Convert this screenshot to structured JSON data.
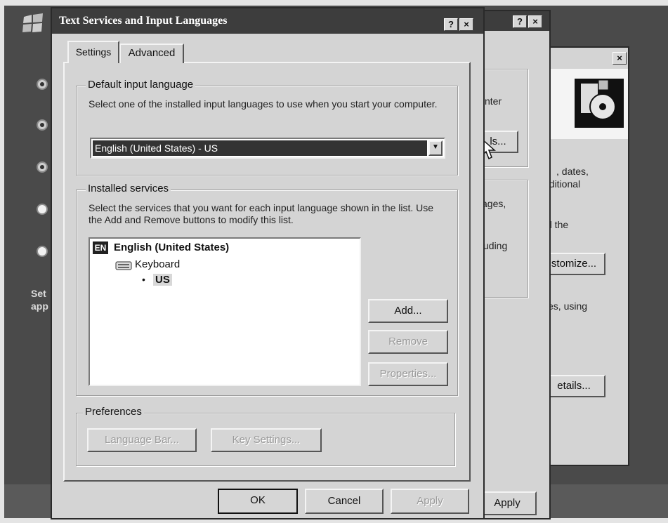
{
  "desktop": {
    "side_text_line1": "Set",
    "side_text_line2": "app"
  },
  "third_window": {
    "frag_dates": ", dates,",
    "frag_additional": "dditional",
    "frag_the": "d the",
    "customize_button": "stomize...",
    "frag_using": "es, using",
    "details_button": "etails..."
  },
  "second_window": {
    "help_btn": "?",
    "close_btn": "×",
    "frag_enter": "nter",
    "frag_button": "ls...",
    "frag_ages": "ages,",
    "frag_uding": "uding",
    "apply_button": "Apply"
  },
  "dialog": {
    "title": "Text Services and Input Languages",
    "help_btn": "?",
    "close_btn": "×",
    "tabs": [
      "Settings",
      "Advanced"
    ],
    "default_language": {
      "label": "Default input language",
      "description": "Select one of the installed input languages to use when you start your computer.",
      "selected": "English (United States) - US"
    },
    "installed_services": {
      "label": "Installed services",
      "description": "Select the services that you want for each input language shown in the list. Use the Add and Remove buttons to modify this list.",
      "language_code": "EN",
      "language": "English (United States)",
      "category": "Keyboard",
      "layout": "US",
      "add_button": "Add...",
      "remove_button": "Remove",
      "properties_button": "Properties..."
    },
    "preferences": {
      "label": "Preferences",
      "language_bar_button": "Language Bar...",
      "key_settings_button": "Key Settings..."
    },
    "footer": {
      "ok": "OK",
      "cancel": "Cancel",
      "apply": "Apply"
    }
  }
}
